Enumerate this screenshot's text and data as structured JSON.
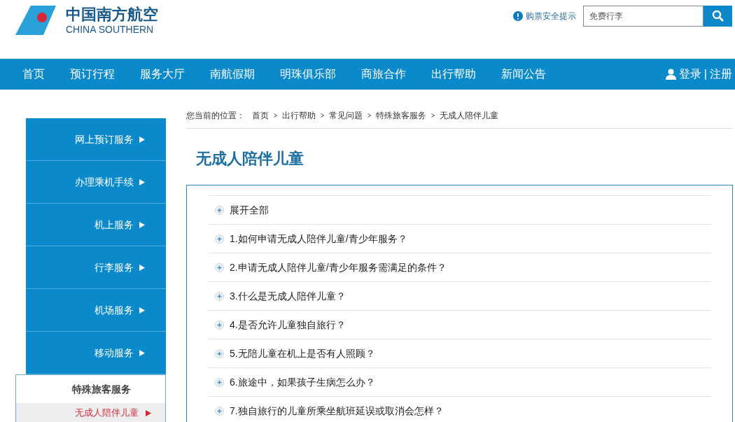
{
  "logo": {
    "name_cn": "中国南方航空",
    "name_en": "CHINA SOUTHERN"
  },
  "safety_tip": "购票安全提示",
  "search": {
    "placeholder": "免费行李"
  },
  "nav": [
    "首页",
    "预订行程",
    "服务大厅",
    "南航假期",
    "明珠俱乐部",
    "商旅合作",
    "出行帮助",
    "新闻公告"
  ],
  "account": {
    "login": "登录",
    "separator": "|",
    "register": "注册"
  },
  "sidebar": {
    "items": [
      "网上预订服务",
      "办理乘机手续",
      "机上服务",
      "行李服务",
      "机场服务",
      "移动服务"
    ],
    "section": {
      "title": "特殊旅客服务",
      "items": [
        {
          "label": "无成人陪伴儿童",
          "selected": true
        }
      ]
    }
  },
  "breadcrumb": {
    "label": "您当前的位置：",
    "crumbs": [
      "首页",
      "出行帮助",
      "常见问题",
      "特殊旅客服务",
      "无成人陪伴儿童"
    ]
  },
  "title": "无成人陪伴儿童",
  "faq": {
    "expand_all": "展开全部",
    "questions": [
      "1.如何申请无成人陪伴儿童/青少年服务？",
      "2.申请无成人陪伴儿童/青少年服务需满足的条件？",
      "3.什么是无成人陪伴儿童？",
      "4.是否允许儿童独自旅行？",
      "5.无陪儿童在机上是否有人照顾？",
      "6.旅途中，如果孩子生病怎么办？",
      "7.独自旅行的儿童所乘坐航班延误或取消会怎样？"
    ]
  }
}
